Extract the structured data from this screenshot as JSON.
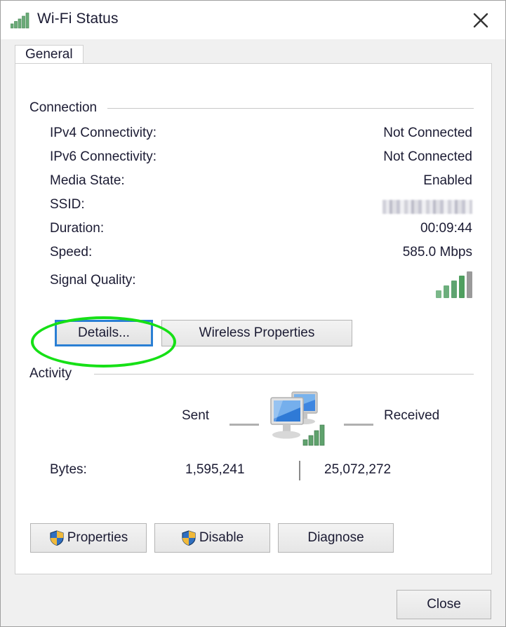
{
  "window": {
    "title": "Wi-Fi Status",
    "title_icon": "wifi-signal-icon",
    "close_icon": "close-icon"
  },
  "tabs": [
    {
      "label": "General",
      "selected": true
    }
  ],
  "connection": {
    "group_label": "Connection",
    "rows": [
      {
        "label": "IPv4 Connectivity:",
        "value": "Not Connected",
        "kind": "text"
      },
      {
        "label": "IPv6 Connectivity:",
        "value": "Not Connected",
        "kind": "text"
      },
      {
        "label": "Media State:",
        "value": "Enabled",
        "kind": "text"
      },
      {
        "label": "SSID:",
        "value": "",
        "kind": "redacted"
      },
      {
        "label": "Duration:",
        "value": "00:09:44",
        "kind": "text"
      },
      {
        "label": "Speed:",
        "value": "585.0 Mbps",
        "kind": "text"
      },
      {
        "label": "Signal Quality:",
        "value": "",
        "kind": "signal"
      }
    ],
    "signal_quality": {
      "bars_total": 5,
      "bars_active": 4,
      "active_color": "#4f9f5f",
      "inactive_color": "#9a9a9a"
    },
    "buttons": [
      {
        "label": "Details...",
        "focused": true,
        "shield": false
      },
      {
        "label": "Wireless Properties",
        "focused": false,
        "shield": false
      }
    ]
  },
  "activity": {
    "group_label": "Activity",
    "sent_label": "Sent",
    "received_label": "Received",
    "center_icon": "two-computers-icon",
    "bytes_label": "Bytes:",
    "bytes_sent": "1,595,241",
    "bytes_received": "25,072,272"
  },
  "action_buttons": [
    {
      "label": "Properties",
      "shield": true
    },
    {
      "label": "Disable",
      "shield": true
    },
    {
      "label": "Diagnose",
      "shield": false
    }
  ],
  "footer": {
    "close_label": "Close"
  },
  "annotation": {
    "shape": "ellipse",
    "color": "#16e016",
    "targets": "Details... button"
  },
  "colors": {
    "window_bg": "#f0f0f0",
    "panel_bg": "#ffffff",
    "text": "#1b1b33",
    "group_line": "#c8c8c8",
    "focus_blue": "#2a7fd4",
    "annotation_green": "#16e016"
  }
}
